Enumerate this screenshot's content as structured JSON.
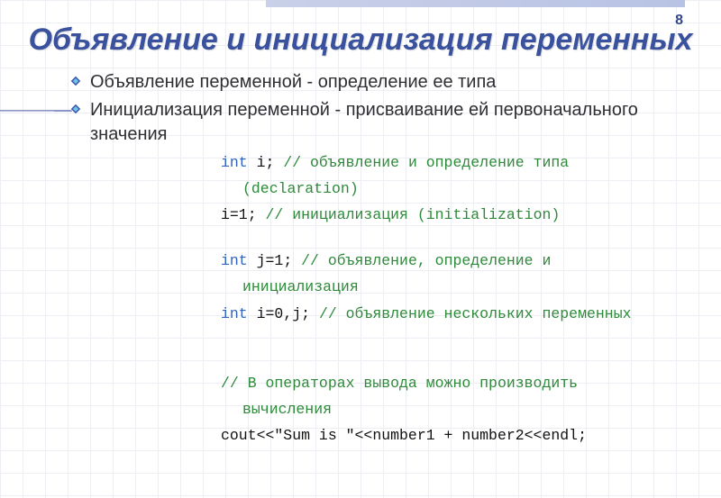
{
  "page_number": "8",
  "title": "Объявление и инициализация переменных",
  "bullets": [
    "Объявление переменной - определение ее типа",
    "Инициализация переменной - присваивание ей первоначального значения"
  ],
  "code": {
    "l1_kw": "int",
    "l1_plain": " i; ",
    "l1_comment": "// объявление и определение типа",
    "l1b_comment": "(declaration)",
    "l2_plain": "i=1;   ",
    "l2_comment": "// инициализация (initialization)",
    "l3_kw": "int",
    "l3_plain": " j=1; ",
    "l3_comment": "// объявление, определение и",
    "l3b_comment": "инициализация",
    "l4_kw": "int",
    "l4_plain": " i=0,j; ",
    "l4_comment": "// объявление нескольких переменных",
    "l5_comment": "// В операторах вывода можно производить",
    "l5b_comment": "вычисления",
    "l6_plain": "cout<<\"Sum is \"<<number1 + number2<<endl;"
  }
}
